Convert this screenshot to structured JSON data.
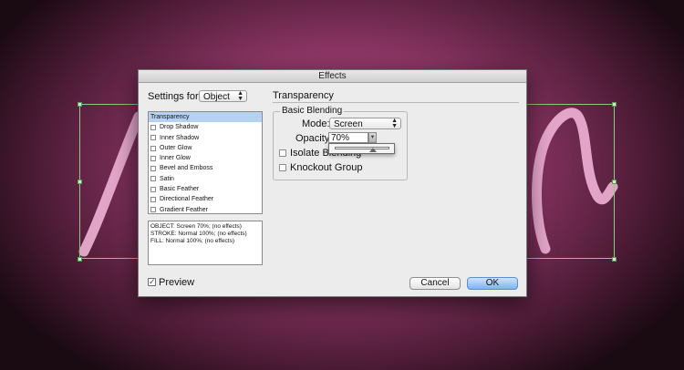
{
  "dialog": {
    "title": "Effects",
    "settings_for_label": "Settings for:",
    "settings_for_value": "Object",
    "effects_list": [
      {
        "label": "Transparency",
        "selected": true,
        "has_checkbox": false
      },
      {
        "label": "Drop Shadow",
        "selected": false,
        "has_checkbox": true
      },
      {
        "label": "Inner Shadow",
        "selected": false,
        "has_checkbox": true
      },
      {
        "label": "Outer Glow",
        "selected": false,
        "has_checkbox": true
      },
      {
        "label": "Inner Glow",
        "selected": false,
        "has_checkbox": true
      },
      {
        "label": "Bevel and Emboss",
        "selected": false,
        "has_checkbox": true
      },
      {
        "label": "Satin",
        "selected": false,
        "has_checkbox": true
      },
      {
        "label": "Basic Feather",
        "selected": false,
        "has_checkbox": true
      },
      {
        "label": "Directional Feather",
        "selected": false,
        "has_checkbox": true
      },
      {
        "label": "Gradient Feather",
        "selected": false,
        "has_checkbox": true
      }
    ],
    "summary_lines": [
      "OBJECT: Screen 70%; (no effects)",
      "STROKE: Normal 100%; (no effects)",
      "FILL: Normal 100%; (no effects)"
    ],
    "section_title": "Transparency",
    "basic_blending_label": "Basic Blending",
    "mode_label": "Mode:",
    "mode_value": "Screen",
    "opacity_label": "Opacity:",
    "opacity_value": "70%",
    "opacity_slider_level": 0.7,
    "isolate_blending_label": "Isolate Blending",
    "knockout_group_label": "Knockout Group",
    "preview_label": "Preview",
    "preview_checked": true,
    "cancel_label": "Cancel",
    "ok_label": "OK"
  },
  "colors": {
    "canvas_pink": "#b04d86",
    "stroke_pink": "#f0b2d6",
    "selection_green": "#8fc98a",
    "default_button_blue": "#7fb3ee"
  }
}
